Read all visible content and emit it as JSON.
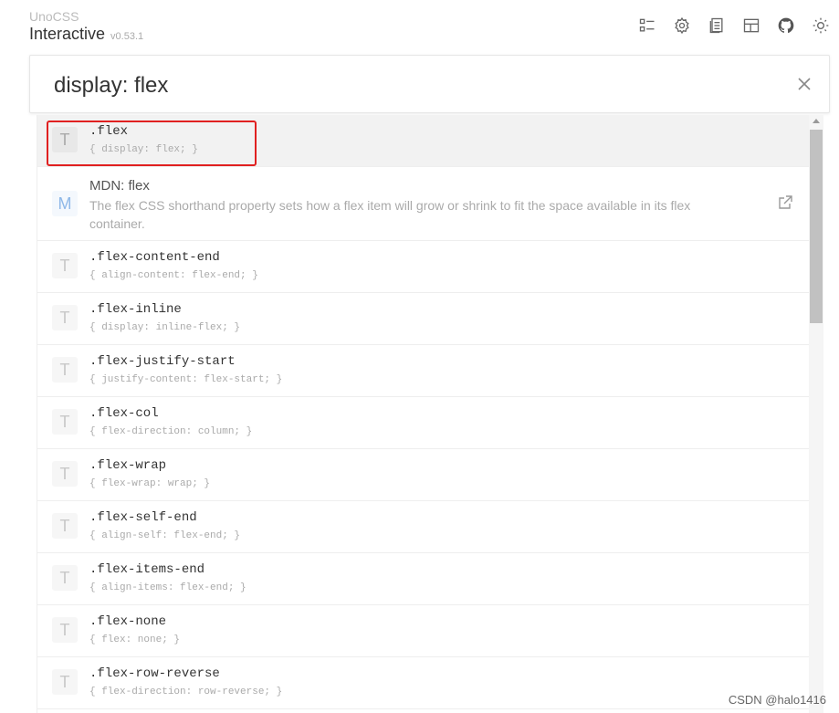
{
  "header": {
    "brand_top": "UnoCSS",
    "brand_main": "Interactive",
    "version": "v0.53.1"
  },
  "toolbar": [
    {
      "name": "list-icon-button"
    },
    {
      "name": "settings-icon-button"
    },
    {
      "name": "docs-icon-button"
    },
    {
      "name": "layout-icon-button"
    },
    {
      "name": "github-icon-button"
    },
    {
      "name": "theme-icon-button"
    }
  ],
  "search": {
    "value": "display: flex",
    "placeholder": ""
  },
  "results": {
    "selected": {
      "icon": "T",
      "selector": ".flex",
      "css": "{ display: flex; }"
    },
    "mdn": {
      "icon": "M",
      "title": "MDN: flex",
      "desc": "The flex CSS shorthand property sets how a flex item will grow or shrink to fit the space available in its flex container."
    },
    "items": [
      {
        "icon": "T",
        "selector": ".flex-content-end",
        "css": "{ align-content: flex-end; }"
      },
      {
        "icon": "T",
        "selector": ".flex-inline",
        "css": "{ display: inline-flex; }"
      },
      {
        "icon": "T",
        "selector": ".flex-justify-start",
        "css": "{ justify-content: flex-start; }"
      },
      {
        "icon": "T",
        "selector": ".flex-col",
        "css": "{ flex-direction: column; }"
      },
      {
        "icon": "T",
        "selector": ".flex-wrap",
        "css": "{ flex-wrap: wrap; }"
      },
      {
        "icon": "T",
        "selector": ".flex-self-end",
        "css": "{ align-self: flex-end; }"
      },
      {
        "icon": "T",
        "selector": ".flex-items-end",
        "css": "{ align-items: flex-end; }"
      },
      {
        "icon": "T",
        "selector": ".flex-none",
        "css": "{ flex: none; }"
      },
      {
        "icon": "T",
        "selector": ".flex-row-reverse",
        "css": "{ flex-direction: row-reverse; }"
      }
    ]
  },
  "watermark": "CSDN @halo1416",
  "colors": {
    "highlight": "#e02020",
    "mdn_icon": "#8fb8e8"
  }
}
